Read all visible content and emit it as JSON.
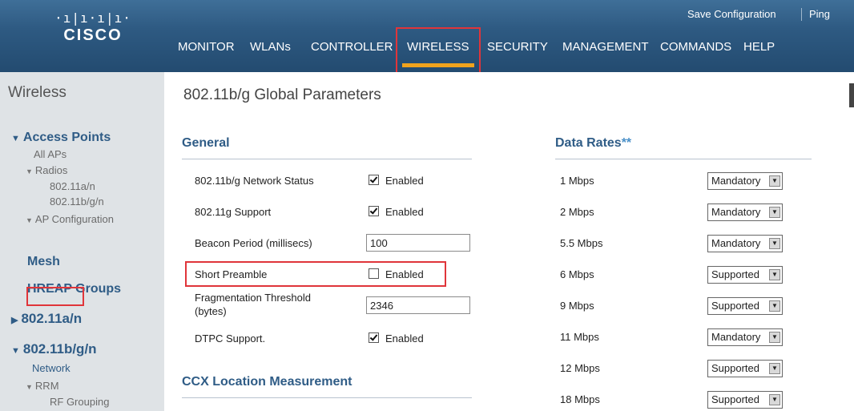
{
  "header": {
    "logo_bars": "·ı|ı·ı|ı·",
    "logo_word": "CISCO",
    "save_configuration": "Save Configuration",
    "ping": "Ping",
    "menu": [
      "MONITOR",
      "WLANs",
      "CONTROLLER",
      "WIRELESS",
      "SECURITY",
      "MANAGEMENT",
      "COMMANDS",
      "HELP"
    ],
    "active_menu": "WIRELESS",
    "highlight_color": "#e0353a",
    "active_underline_color": "#f0a31d"
  },
  "sidebar": {
    "title": "Wireless",
    "access_points": "Access Points",
    "all_aps": "All APs",
    "radios": "Radios",
    "radio_a": "802.11a/n",
    "radio_bg": "802.11b/g/n",
    "ap_configuration": "AP Configuration",
    "mesh": "Mesh",
    "hreap_groups": "HREAP Groups",
    "band_a": "802.11a/n",
    "band_bg": "802.11b/g/n",
    "network": "Network",
    "rrm": "RRM",
    "rf_grouping": "RF Grouping"
  },
  "main": {
    "title": "802.11b/g Global Parameters",
    "general": {
      "heading": "General",
      "network_status_label": "802.11b/g Network Status",
      "network_status_enabled": true,
      "g_support_label": "802.11g Support",
      "g_support_enabled": true,
      "beacon_label": "Beacon Period (millisecs)",
      "beacon_value": "100",
      "short_preamble_label": "Short Preamble",
      "short_preamble_enabled": false,
      "frag_label_line1": "Fragmentation Threshold",
      "frag_label_line2": "(bytes)",
      "frag_value": "2346",
      "dtpc_label": "DTPC Support.",
      "dtpc_enabled": true,
      "enabled_text": "Enabled"
    },
    "ccx_heading": "CCX Location Measurement",
    "data_rates": {
      "heading": "Data Rates",
      "heading_mark": "**",
      "rates": [
        {
          "rate": "1 Mbps",
          "value": "Mandatory"
        },
        {
          "rate": "2 Mbps",
          "value": "Mandatory"
        },
        {
          "rate": "5.5 Mbps",
          "value": "Mandatory"
        },
        {
          "rate": "6 Mbps",
          "value": "Supported"
        },
        {
          "rate": "9 Mbps",
          "value": "Supported"
        },
        {
          "rate": "11 Mbps",
          "value": "Mandatory"
        },
        {
          "rate": "12 Mbps",
          "value": "Supported"
        },
        {
          "rate": "18 Mbps",
          "value": "Supported"
        }
      ]
    }
  }
}
